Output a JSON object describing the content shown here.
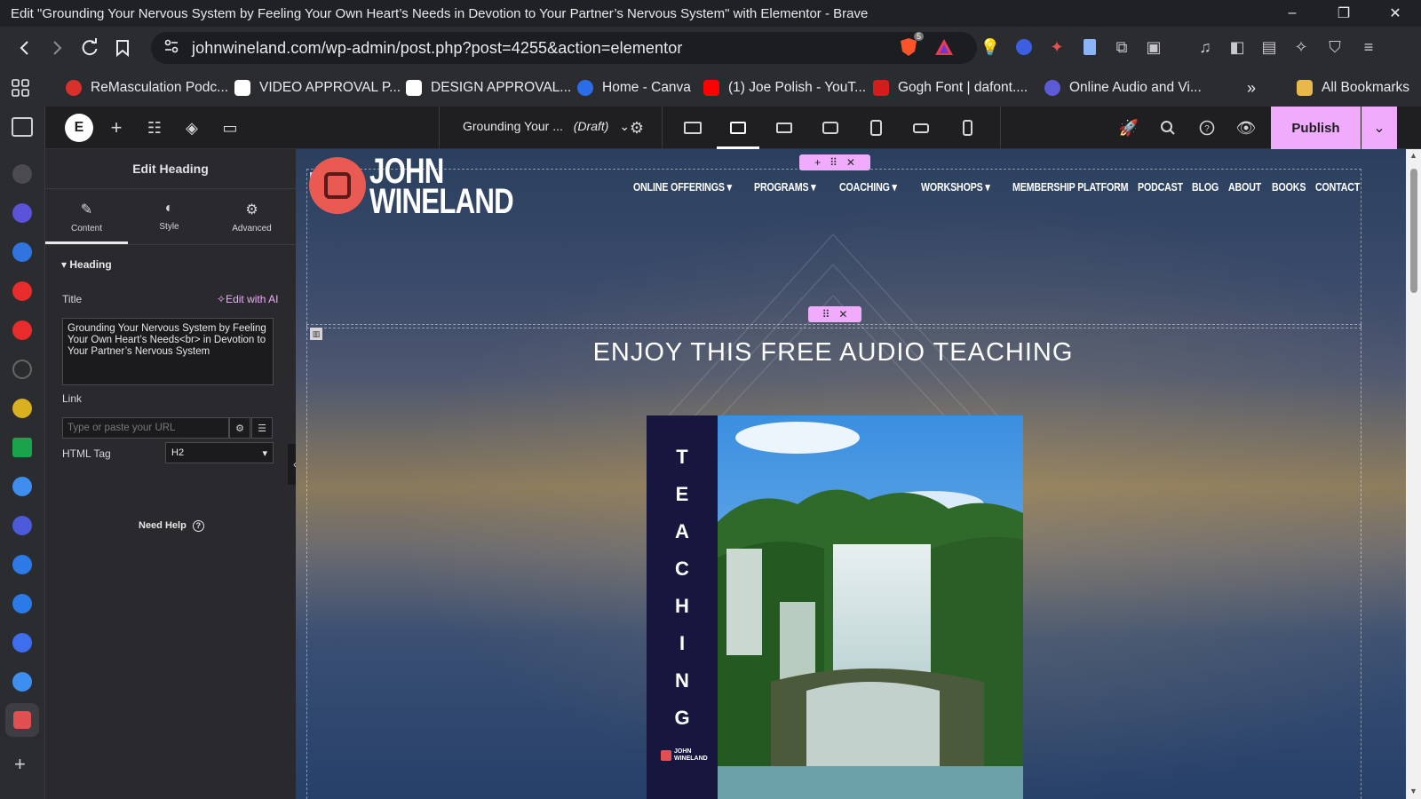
{
  "window": {
    "title": "Edit \"Grounding Your Nervous System by Feeling Your Own Heart’s Needs in Devotion to Your Partner’s Nervous System\" with Elementor - Brave",
    "controls": [
      "–",
      "❐",
      "✕"
    ]
  },
  "browser": {
    "url": "johnwineland.com/wp-admin/post.php?post=4255&action=elementor",
    "shield_count": "5",
    "bookmarks": [
      {
        "label": "ReMasculation Podc...",
        "color": "#d9302c"
      },
      {
        "label": "VIDEO APPROVAL P...",
        "color": "#e8e8e8"
      },
      {
        "label": "DESIGN APPROVAL...",
        "color": "#e8e8e8"
      },
      {
        "label": "Home - Canva",
        "color": "#2b6de8"
      },
      {
        "label": "(1) Joe Polish - YouT...",
        "color": "#ff0000"
      },
      {
        "label": "Gogh Font | dafont....",
        "color": "#d41c1c"
      },
      {
        "label": "Online Audio and Vi...",
        "color": "#5b5bd6"
      }
    ],
    "overflow": "»",
    "all_bookmarks": "All Bookmarks"
  },
  "elementor": {
    "doc_title": "Grounding Your ...",
    "doc_status": "(Draft)",
    "publish_label": "Publish"
  },
  "panel": {
    "title": "Edit Heading",
    "tabs": [
      {
        "label": "Content",
        "icon": "pencil-icon"
      },
      {
        "label": "Style",
        "icon": "contrast-icon"
      },
      {
        "label": "Advanced",
        "icon": "gear-icon"
      }
    ],
    "section_title": "Heading",
    "title_label": "Title",
    "edit_ai": "Edit with AI",
    "title_value": "Grounding Your Nervous System by Feeling Your Own Heart’s Needs<br> in Devotion to Your Partner’s Nervous System",
    "link_label": "Link",
    "link_placeholder": "Type or paste your URL",
    "html_tag_label": "HTML Tag",
    "html_tag_value": "H2",
    "need_help": "Need Help"
  },
  "site": {
    "logo_line1": "JOHN",
    "logo_line2": "WINELAND",
    "nav": [
      "ONLINE OFFERINGS",
      "PROGRAMS",
      "COACHING",
      "WORKSHOPS",
      "MEMBERSHIP PLATFORM",
      "PODCAST",
      "BLOG",
      "ABOUT",
      "BOOKS",
      "CONTACT"
    ],
    "heading": "ENJOY THIS FREE AUDIO TEACHING",
    "vertical_word": [
      "T",
      "E",
      "A",
      "C",
      "H",
      "I",
      "N",
      "G"
    ],
    "mini_logo": "JOHN WINELAND"
  }
}
